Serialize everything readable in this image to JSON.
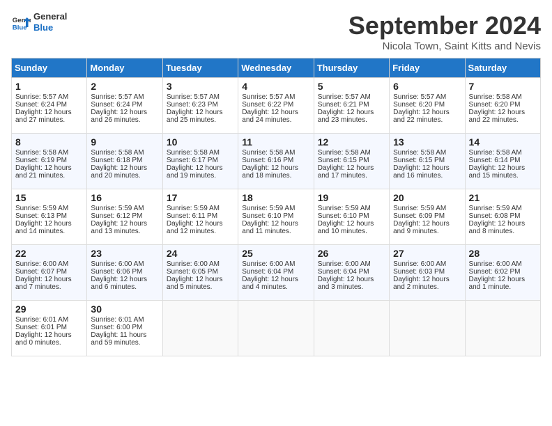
{
  "header": {
    "logo_line1": "General",
    "logo_line2": "Blue",
    "month_title": "September 2024",
    "subtitle": "Nicola Town, Saint Kitts and Nevis"
  },
  "days_of_week": [
    "Sunday",
    "Monday",
    "Tuesday",
    "Wednesday",
    "Thursday",
    "Friday",
    "Saturday"
  ],
  "weeks": [
    [
      {
        "day": "1",
        "sunrise": "Sunrise: 5:57 AM",
        "sunset": "Sunset: 6:24 PM",
        "daylight": "Daylight: 12 hours and 27 minutes."
      },
      {
        "day": "2",
        "sunrise": "Sunrise: 5:57 AM",
        "sunset": "Sunset: 6:24 PM",
        "daylight": "Daylight: 12 hours and 26 minutes."
      },
      {
        "day": "3",
        "sunrise": "Sunrise: 5:57 AM",
        "sunset": "Sunset: 6:23 PM",
        "daylight": "Daylight: 12 hours and 25 minutes."
      },
      {
        "day": "4",
        "sunrise": "Sunrise: 5:57 AM",
        "sunset": "Sunset: 6:22 PM",
        "daylight": "Daylight: 12 hours and 24 minutes."
      },
      {
        "day": "5",
        "sunrise": "Sunrise: 5:57 AM",
        "sunset": "Sunset: 6:21 PM",
        "daylight": "Daylight: 12 hours and 23 minutes."
      },
      {
        "day": "6",
        "sunrise": "Sunrise: 5:57 AM",
        "sunset": "Sunset: 6:20 PM",
        "daylight": "Daylight: 12 hours and 22 minutes."
      },
      {
        "day": "7",
        "sunrise": "Sunrise: 5:58 AM",
        "sunset": "Sunset: 6:20 PM",
        "daylight": "Daylight: 12 hours and 22 minutes."
      }
    ],
    [
      {
        "day": "8",
        "sunrise": "Sunrise: 5:58 AM",
        "sunset": "Sunset: 6:19 PM",
        "daylight": "Daylight: 12 hours and 21 minutes."
      },
      {
        "day": "9",
        "sunrise": "Sunrise: 5:58 AM",
        "sunset": "Sunset: 6:18 PM",
        "daylight": "Daylight: 12 hours and 20 minutes."
      },
      {
        "day": "10",
        "sunrise": "Sunrise: 5:58 AM",
        "sunset": "Sunset: 6:17 PM",
        "daylight": "Daylight: 12 hours and 19 minutes."
      },
      {
        "day": "11",
        "sunrise": "Sunrise: 5:58 AM",
        "sunset": "Sunset: 6:16 PM",
        "daylight": "Daylight: 12 hours and 18 minutes."
      },
      {
        "day": "12",
        "sunrise": "Sunrise: 5:58 AM",
        "sunset": "Sunset: 6:15 PM",
        "daylight": "Daylight: 12 hours and 17 minutes."
      },
      {
        "day": "13",
        "sunrise": "Sunrise: 5:58 AM",
        "sunset": "Sunset: 6:15 PM",
        "daylight": "Daylight: 12 hours and 16 minutes."
      },
      {
        "day": "14",
        "sunrise": "Sunrise: 5:58 AM",
        "sunset": "Sunset: 6:14 PM",
        "daylight": "Daylight: 12 hours and 15 minutes."
      }
    ],
    [
      {
        "day": "15",
        "sunrise": "Sunrise: 5:59 AM",
        "sunset": "Sunset: 6:13 PM",
        "daylight": "Daylight: 12 hours and 14 minutes."
      },
      {
        "day": "16",
        "sunrise": "Sunrise: 5:59 AM",
        "sunset": "Sunset: 6:12 PM",
        "daylight": "Daylight: 12 hours and 13 minutes."
      },
      {
        "day": "17",
        "sunrise": "Sunrise: 5:59 AM",
        "sunset": "Sunset: 6:11 PM",
        "daylight": "Daylight: 12 hours and 12 minutes."
      },
      {
        "day": "18",
        "sunrise": "Sunrise: 5:59 AM",
        "sunset": "Sunset: 6:10 PM",
        "daylight": "Daylight: 12 hours and 11 minutes."
      },
      {
        "day": "19",
        "sunrise": "Sunrise: 5:59 AM",
        "sunset": "Sunset: 6:10 PM",
        "daylight": "Daylight: 12 hours and 10 minutes."
      },
      {
        "day": "20",
        "sunrise": "Sunrise: 5:59 AM",
        "sunset": "Sunset: 6:09 PM",
        "daylight": "Daylight: 12 hours and 9 minutes."
      },
      {
        "day": "21",
        "sunrise": "Sunrise: 5:59 AM",
        "sunset": "Sunset: 6:08 PM",
        "daylight": "Daylight: 12 hours and 8 minutes."
      }
    ],
    [
      {
        "day": "22",
        "sunrise": "Sunrise: 6:00 AM",
        "sunset": "Sunset: 6:07 PM",
        "daylight": "Daylight: 12 hours and 7 minutes."
      },
      {
        "day": "23",
        "sunrise": "Sunrise: 6:00 AM",
        "sunset": "Sunset: 6:06 PM",
        "daylight": "Daylight: 12 hours and 6 minutes."
      },
      {
        "day": "24",
        "sunrise": "Sunrise: 6:00 AM",
        "sunset": "Sunset: 6:05 PM",
        "daylight": "Daylight: 12 hours and 5 minutes."
      },
      {
        "day": "25",
        "sunrise": "Sunrise: 6:00 AM",
        "sunset": "Sunset: 6:04 PM",
        "daylight": "Daylight: 12 hours and 4 minutes."
      },
      {
        "day": "26",
        "sunrise": "Sunrise: 6:00 AM",
        "sunset": "Sunset: 6:04 PM",
        "daylight": "Daylight: 12 hours and 3 minutes."
      },
      {
        "day": "27",
        "sunrise": "Sunrise: 6:00 AM",
        "sunset": "Sunset: 6:03 PM",
        "daylight": "Daylight: 12 hours and 2 minutes."
      },
      {
        "day": "28",
        "sunrise": "Sunrise: 6:00 AM",
        "sunset": "Sunset: 6:02 PM",
        "daylight": "Daylight: 12 hours and 1 minute."
      }
    ],
    [
      {
        "day": "29",
        "sunrise": "Sunrise: 6:01 AM",
        "sunset": "Sunset: 6:01 PM",
        "daylight": "Daylight: 12 hours and 0 minutes."
      },
      {
        "day": "30",
        "sunrise": "Sunrise: 6:01 AM",
        "sunset": "Sunset: 6:00 PM",
        "daylight": "Daylight: 11 hours and 59 minutes."
      },
      null,
      null,
      null,
      null,
      null
    ]
  ]
}
